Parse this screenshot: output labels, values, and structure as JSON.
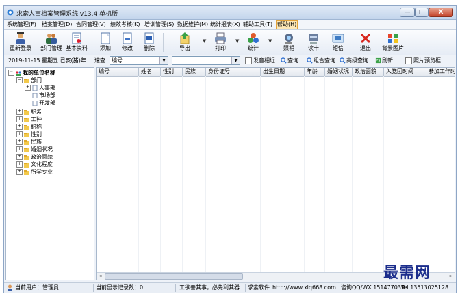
{
  "caption": "",
  "window": {
    "title": "求索人事档案管理系统 v13.4 单机版",
    "min_label": "—",
    "max_label": "□",
    "close_label": "X"
  },
  "menu": [
    "系统管理(F)",
    "档案管理(D)",
    "合同管理(V)",
    "绩效考核(K)",
    "培训管理(S)",
    "数据维护(M)",
    "统计报表(X)",
    "辅助工具(T)",
    "帮助(H)"
  ],
  "toolbar": {
    "relogin": "重新登录",
    "dept": "部门管理",
    "basic": "基本资料",
    "add": "添加",
    "edit": "修改",
    "delete": "删除",
    "export": "导出",
    "print": "打印",
    "stats": "统计",
    "photo": "照相",
    "readcard": "读卡",
    "sms": "短信",
    "exit": "退出",
    "bgimage": "背景图片"
  },
  "searchbar": {
    "date": "2019-11-15 星期五 己亥(猪)年",
    "query_label": "速查",
    "field_value": "编号",
    "keyword_value": "",
    "similar": "发音相近",
    "query": "查询",
    "combined": "组合查询",
    "advanced": "高级查询",
    "refresh": "刷新",
    "photo_preview": "照片预览框"
  },
  "tree": {
    "root": "我的单位名称",
    "dept": "部门",
    "dept_children": [
      "人事部",
      "市场部",
      "开发部"
    ],
    "others": [
      "职务",
      "工种",
      "职称",
      "性别",
      "民族",
      "婚姻状况",
      "政治面貌",
      "文化程度",
      "所学专业"
    ]
  },
  "grid": {
    "columns": [
      "编号",
      "姓名",
      "性别",
      "民族",
      "身份证号",
      "出生日期",
      "年龄",
      "婚姻状况",
      "政治面貌",
      "入党团时间",
      "参加工作时间"
    ]
  },
  "status": {
    "user": "当前用户：管理员",
    "records": "当前显示记录数：0",
    "slogan": "工欲善其事，必先利其器",
    "software": "求索软件",
    "website": "http://www.xlq668.com",
    "qq": "咨询QQ/WX 151477039",
    "tel": "Tel 13513025128"
  },
  "watermark": "最需网"
}
